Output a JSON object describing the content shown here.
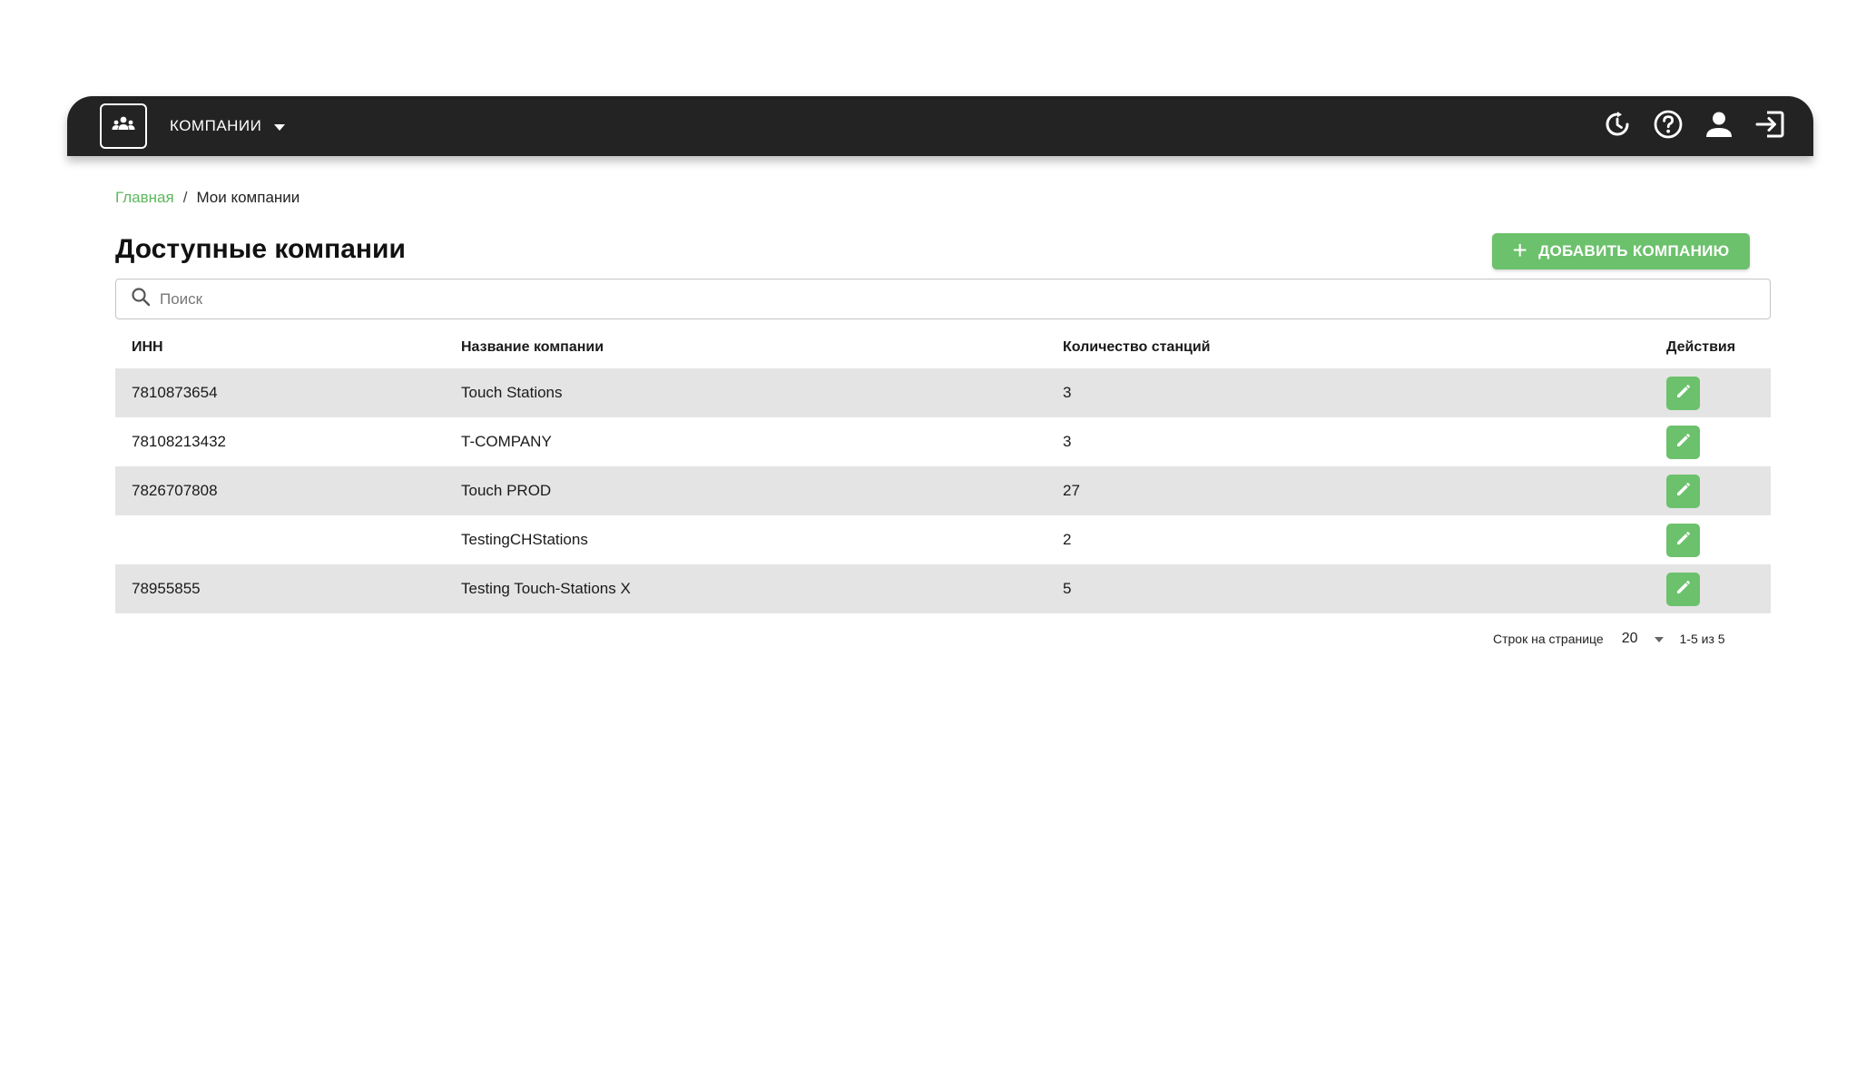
{
  "header": {
    "company_menu_label": "КОМПАНИИ",
    "icons": [
      "team-icon",
      "refresh-clock-icon",
      "help-icon",
      "user-icon",
      "logout-icon"
    ],
    "background_color": "#232323"
  },
  "breadcrumb": {
    "home": "Главная",
    "separator": "/",
    "current": "Мои компании"
  },
  "page": {
    "title": "Доступные компании",
    "add_button_label": "ДОБАВИТЬ КОМПАНИЮ",
    "accent_color": "#6cc16c"
  },
  "search": {
    "placeholder": "Поиск",
    "value": ""
  },
  "table": {
    "columns": {
      "inn": "ИНН",
      "name": "Название компании",
      "stations": "Количество станций",
      "actions": "Действия"
    },
    "rows": [
      {
        "inn": "7810873654",
        "name": "Touch Stations",
        "stations": "3"
      },
      {
        "inn": "78108213432",
        "name": "T-COMPANY",
        "stations": "3"
      },
      {
        "inn": "7826707808",
        "name": "Touch PROD",
        "stations": "27"
      },
      {
        "inn": "",
        "name": "TestingCHStations",
        "stations": "2"
      },
      {
        "inn": "78955855",
        "name": "Testing Touch-Stations X",
        "stations": "5"
      }
    ]
  },
  "pagination": {
    "rows_per_page_label": "Строк на странице",
    "rows_per_page_value": "20",
    "range": "1-5 из 5"
  }
}
